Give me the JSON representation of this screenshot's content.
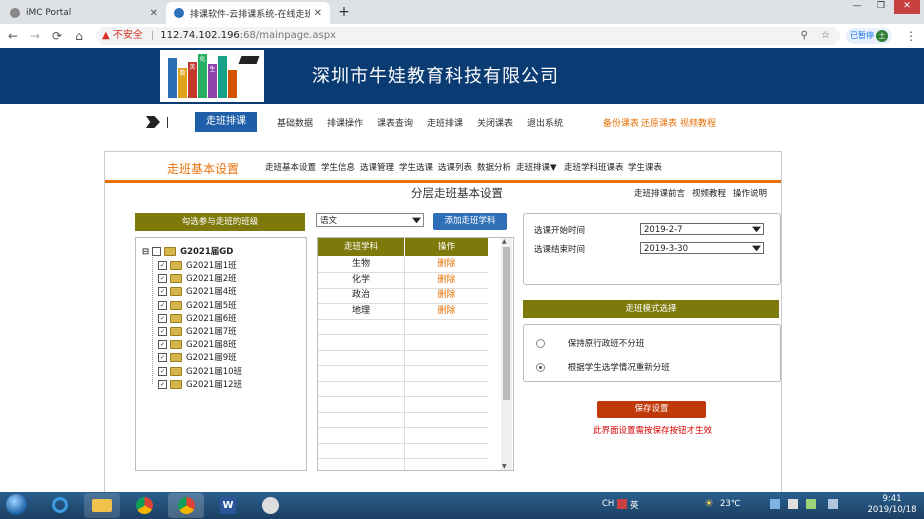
{
  "browser": {
    "tabs": [
      {
        "title": "iMC Portal",
        "active": false
      },
      {
        "title": "排课软件-云排课系统-在线走班排",
        "active": true
      }
    ],
    "new_tab": "+",
    "window_buttons": [
      "—",
      "❐",
      "✕"
    ],
    "nav_icons": [
      "←",
      "→",
      "⟳",
      "⌂"
    ],
    "address": {
      "warning_icon": "▲",
      "insecure_label": "不安全",
      "separator": "|",
      "host": "112.74.102.196",
      "path": ":68/mainpage.aspx"
    },
    "right_icons": [
      "⚲",
      "☆"
    ],
    "profile_label": "已暂停",
    "profile_initial": "土",
    "menu_icon": "⋮"
  },
  "site": {
    "company_name": "深圳市牛娃教育科技有限公司",
    "book_labels": [
      "数",
      "英",
      "化",
      "生"
    ]
  },
  "top_nav": {
    "active": "走班排课",
    "items": [
      "基础数据",
      "排课操作",
      "课表查询",
      "走班排课",
      "关闭课表",
      "退出系统"
    ],
    "right_links": [
      "备份课表",
      "还原课表",
      "视频教程"
    ]
  },
  "sub_nav": {
    "title": "走班基本设置",
    "items": [
      "走班基本设置",
      "学生信息",
      "选课管理",
      "学生选课",
      "选课列表",
      "数据分析",
      "走班排课▼",
      "走班学科班课表",
      "学生课表"
    ]
  },
  "content": {
    "title": "分层走班基本设置",
    "links": [
      "走班排课前言",
      "视频教程",
      "操作说明"
    ]
  },
  "left_panel": {
    "header": "勾选参与走班的班级",
    "root": {
      "expander": "⊟",
      "checked": false,
      "label": "G2021届GD"
    },
    "classes": [
      {
        "label": "G2021届1班",
        "checked": true
      },
      {
        "label": "G2021届2班",
        "checked": true
      },
      {
        "label": "G2021届4班",
        "checked": true
      },
      {
        "label": "G2021届5班",
        "checked": true
      },
      {
        "label": "G2021届6班",
        "checked": true
      },
      {
        "label": "G2021届7班",
        "checked": true
      },
      {
        "label": "G2021届8班",
        "checked": true
      },
      {
        "label": "G2021届9班",
        "checked": true
      },
      {
        "label": "G2021届10班",
        "checked": true
      },
      {
        "label": "G2021届12班",
        "checked": true
      }
    ]
  },
  "subject_panel": {
    "selected_subject": "语文",
    "add_button": "添加走班学科",
    "columns": [
      "走班学科",
      "操作"
    ],
    "rows": [
      {
        "subject": "生物",
        "action": "删除"
      },
      {
        "subject": "化学",
        "action": "删除"
      },
      {
        "subject": "政治",
        "action": "删除"
      },
      {
        "subject": "地理",
        "action": "删除"
      }
    ],
    "scroll_up": "▲",
    "scroll_down": "▼"
  },
  "date_panel": {
    "start_label": "选课开始时间",
    "start_value": "2019-2-7",
    "end_label": "选课结束时间",
    "end_value": "2019-3-30"
  },
  "mode_panel": {
    "header": "走班模式选择",
    "options": [
      {
        "label": "保持原行政班不分班",
        "selected": false
      },
      {
        "label": "根据学生选学情况重新分班",
        "selected": true
      }
    ]
  },
  "save": {
    "button": "保存设置",
    "note": "此界面设置需按保存按钮才生效"
  },
  "taskbar": {
    "apps": [
      "ie",
      "explorer",
      "chrome",
      "chrome",
      "word",
      "app"
    ],
    "lang": "CH",
    "ime_label": "英",
    "weather_icon": "☀",
    "temperature": "23℃",
    "time": "9:41",
    "date": "2019/10/18"
  },
  "colors": {
    "header_bg": "#0b3b73",
    "nav_active": "#1f5ea8",
    "accent_orange": "#e8700a",
    "olive": "#7d7a0b",
    "save_red": "#c0390b"
  }
}
